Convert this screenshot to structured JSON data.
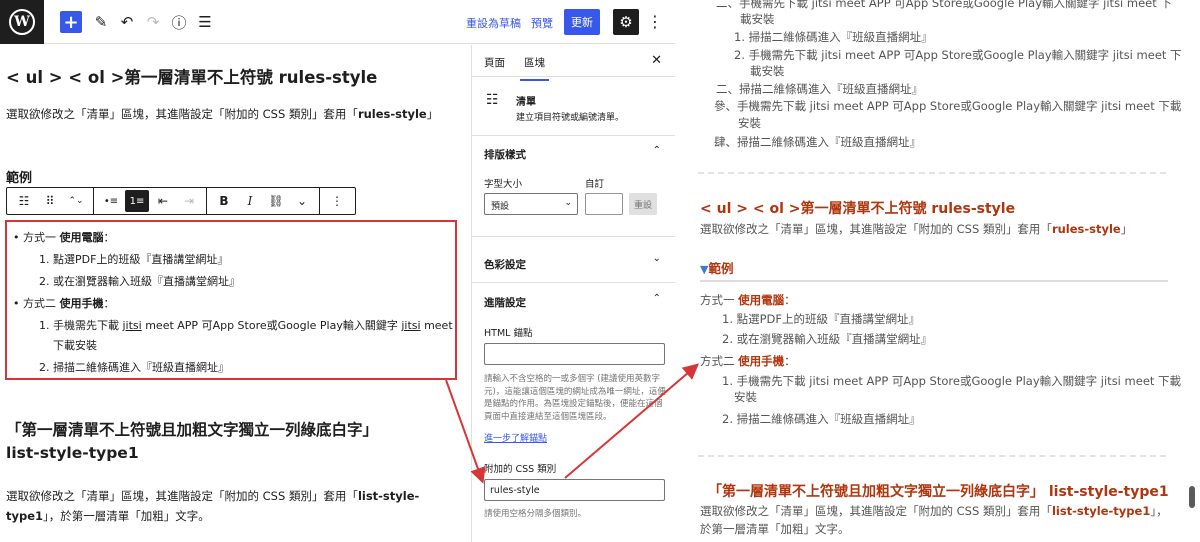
{
  "topbar": {
    "logo": "W",
    "add_icon": "+",
    "pen_icon": "✎",
    "undo_icon": "↶",
    "redo_icon": "↷",
    "info_icon": "ⓘ",
    "outline_icon": "☰",
    "save_draft": "重設為草稿",
    "preview": "預覽",
    "update": "更新",
    "settings_icon": "⚙",
    "more_icon": "⋮"
  },
  "canvas": {
    "heading1": "< ul > < ol >第一層清單不上符號 rules-style",
    "para1_pre": "選取欲修改之「清單」區塊，其進階設定「附加的 CSS 類別」套用「",
    "para1_bold": "rules-style",
    "para1_post": "」",
    "example_heading": "範例",
    "toolbar": {
      "list_icon": "☷",
      "drag_icon": "⠿",
      "move_icon": "⌃⌄",
      "bullets_icon": "•≡",
      "numbered_icon": "1≡",
      "outdent_icon": "⇤",
      "indent_icon": "⇥",
      "bold": "B",
      "italic": "I",
      "link_icon": "⛓",
      "chevron_icon": "⌄",
      "more_icon": "⋮"
    },
    "list": {
      "item1_pre": "• 方式一 ",
      "item1_bold": "使用電腦",
      "item1_post": "：",
      "item1_sub1": "1. 點選PDF上的班級『直播講堂網址』",
      "item1_sub2": "2. 或在瀏覽器輸入班級『直播講堂網址』",
      "item2_pre": "• 方式二 ",
      "item2_bold": "使用手機",
      "item2_post": "：",
      "item2_sub1_a": "1. 手機需先下載 ",
      "item2_sub1_b": "jitsi",
      "item2_sub1_c": " meet APP 可App Store或Google Play輸入關鍵字 ",
      "item2_sub1_d": "jitsi",
      "item2_sub1_e": " meet",
      "item2_sub1_cont": "下載安裝",
      "item2_sub2": "2. 掃描二維條碼進入『班級直播網址』"
    },
    "heading2_line1": "「第一層清單不上符號且加粗文字獨立一列綠底白字」",
    "heading2_line2": "list-style-type1",
    "para2_pre": "選取欲修改之「清單」區塊，其進階設定「附加的 CSS 類別」套用「",
    "para2_bold1": "list-style-",
    "para2_bold2": "type1",
    "para2_post": "」，於第一層清單「加粗」文字。"
  },
  "sidebar": {
    "tab_page": "頁面",
    "tab_block": "區塊",
    "close_icon": "✕",
    "block_icon": "☷",
    "block_name": "清單",
    "block_desc": "建立項目符號或編號清單。",
    "typography_title": "排版樣式",
    "font_size_label": "字型大小",
    "custom_label": "自訂",
    "font_size_value": "預設",
    "reset_label": "重設",
    "color_title": "色彩設定",
    "advanced_title": "進階設定",
    "anchor_label": "HTML 錨點",
    "anchor_value": "",
    "anchor_help": "請輸入不含空格的一或多個字 (建議使用英數字元)，這能讓這個區塊的網址成為唯一網址，這便是錨點的作用。為區塊設定錨點後，便能在這個頁面中直接連結至這個區塊區段。",
    "learn_more": "進一步了解錨點",
    "css_label": "附加的 CSS 類別",
    "css_value": "rules-style",
    "css_help": "請使用空格分隔多個類別。",
    "chevron_up": "⌃",
    "chevron_down": "⌄"
  },
  "preview": {
    "top_line1": "二、手機需先下載 jitsi meet APP 可App Store或Google Play輸入關鍵字 jitsi meet 下",
    "top_line1b": "載安裝",
    "top_line2": "1. 掃描二維條碼進入『班級直播網址』",
    "top_line3": "2. 手機需先下載 jitsi meet APP 可App Store或Google Play輸入關鍵字 jitsi meet 下",
    "top_line3b": "載安裝",
    "top_line4": "二、掃描二維條碼進入『班級直播網址』",
    "top_line5": "參、手機需先下載 jitsi meet APP 可App Store或Google Play輸入關鍵字 jitsi meet 下載",
    "top_line5b": "安裝",
    "top_line6": "肆、掃描二維條碼進入『班級直播網址』",
    "heading1": "< ul > < ol >第一層清單不上符號 rules-style",
    "para1_pre": "選取欲修改之「清單」區塊，其進階設定「附加的 CSS 類別」套用「",
    "para1_red": "rules-style",
    "para1_post": "」",
    "spoiler_icon": "▼",
    "spoiler_label": "範例",
    "ex1_pre": "方式一 ",
    "ex1_red": "使用電腦",
    "ex1_post": "：",
    "ex1_sub1": "1. 點選PDF上的班級『直播講堂網址』",
    "ex1_sub2": "2. 或在瀏覽器輸入班級『直播講堂網址』",
    "ex2_pre": "方式二 ",
    "ex2_red": "使用手機",
    "ex2_post": "：",
    "ex2_sub1": "1. 手機需先下載 jitsi meet APP 可App Store或Google Play輸入關鍵字 jitsi meet 下載",
    "ex2_sub1b": "安裝",
    "ex2_sub2": "2. 掃描二維條碼進入『班級直播網址』",
    "heading2": "「第一層清單不上符號且加粗文字獨立一列綠底白字」 list-style-type1",
    "para2_pre": "選取欲修改之「清單」區塊，其進階設定「附加的 CSS 類別」套用「",
    "para2_red": "list-style-type1",
    "para2_post": "」，",
    "para2_line2": "於第一層清單「加粗」文字。"
  },
  "colors": {
    "accent": "#3858e9",
    "annotation_red": "#d63638",
    "preview_heading": "#b1350d"
  }
}
